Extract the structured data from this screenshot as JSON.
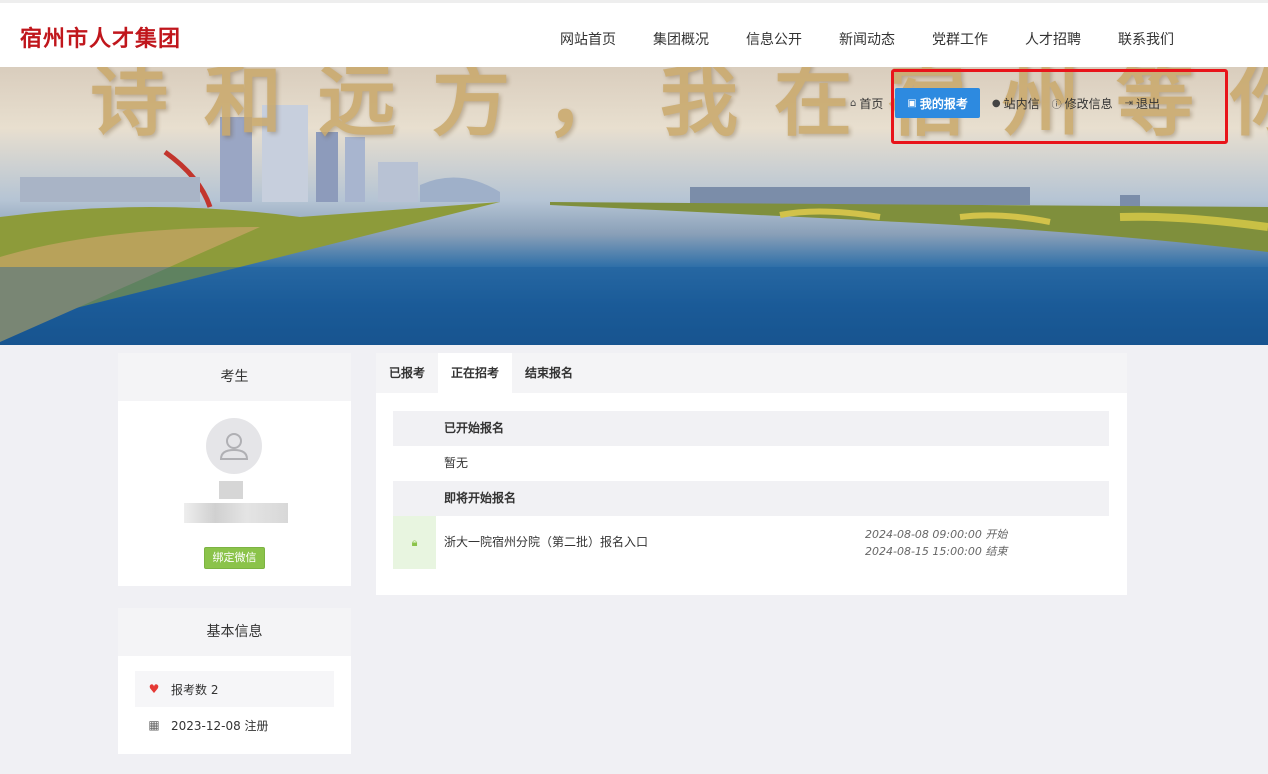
{
  "header": {
    "logo": "宿州市人才集团",
    "nav": [
      "网站首页",
      "集团概况",
      "信息公开",
      "新闻动态",
      "党群工作",
      "人才招聘",
      "联系我们"
    ]
  },
  "banner": {
    "slogan": "诗和远方，我在宿州等你"
  },
  "user_nav": {
    "home": "首页",
    "my_exams": "我的报考",
    "messages": "站内信",
    "edit_info": "修改信息",
    "logout": "退出"
  },
  "profile": {
    "title": "考生",
    "bind_wechat": "绑定微信"
  },
  "basic_info": {
    "title": "基本信息",
    "exam_count": "报考数 2",
    "register_date": "2023-12-08 注册"
  },
  "tabs": [
    "已报考",
    "正在招考",
    "结束报名"
  ],
  "sections": {
    "started_title": "已开始报名",
    "started_empty": "暂无",
    "upcoming_title": "即将开始报名",
    "entry": {
      "name": "浙大一院宿州分院（第二批）报名入口",
      "start": "2024-08-08 09:00:00 开始",
      "end": "2024-08-15 15:00:00 结束"
    }
  },
  "colors": {
    "logo_red": "#c0161c",
    "active_blue": "#2d8ae0",
    "highlight_red": "#e8141a",
    "wechat_green": "#8bc34a"
  },
  "icons": {
    "home": "home-icon",
    "exams": "id-card-icon",
    "messages": "chat-bubble-icon",
    "edit": "info-circle-icon",
    "logout": "sign-out-icon",
    "heart": "heart-icon",
    "calendar": "calendar-icon",
    "lock": "lock-icon",
    "user": "user-avatar-icon"
  }
}
